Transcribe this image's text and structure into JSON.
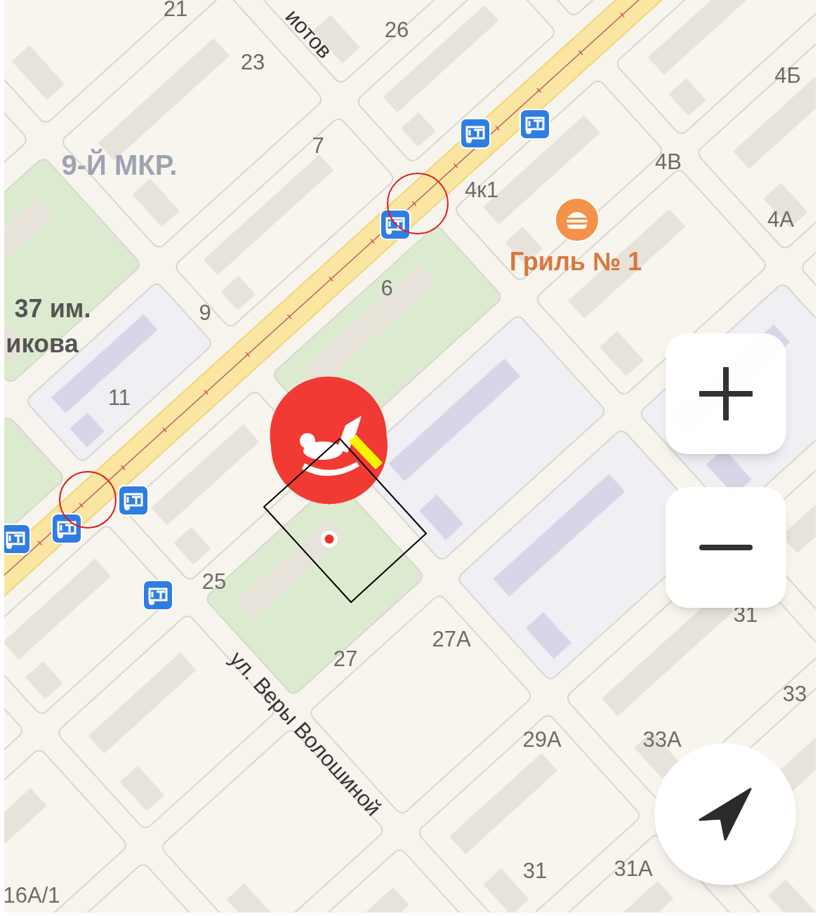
{
  "map": {
    "labels": [
      {
        "kind": "house",
        "text": "21"
      },
      {
        "kind": "street",
        "text": "иотов"
      },
      {
        "kind": "house",
        "text": "26"
      },
      {
        "kind": "house",
        "text": "23"
      },
      {
        "kind": "house",
        "text": "4Б"
      },
      {
        "kind": "house",
        "text": "7"
      },
      {
        "kind": "district",
        "text": "9-Й МКР."
      },
      {
        "kind": "house",
        "text": "4В"
      },
      {
        "kind": "house",
        "text": "4к1"
      },
      {
        "kind": "house",
        "text": "4А"
      },
      {
        "kind": "poi",
        "text": "Гриль № 1"
      },
      {
        "kind": "house",
        "text": "6"
      },
      {
        "kind": "place",
        "text": "37 им."
      },
      {
        "kind": "house",
        "text": "9"
      },
      {
        "kind": "place",
        "text": "икова"
      },
      {
        "kind": "house",
        "text": "11"
      },
      {
        "kind": "house",
        "text": "25"
      },
      {
        "kind": "house",
        "text": "31"
      },
      {
        "kind": "house",
        "text": "27А"
      },
      {
        "kind": "house",
        "text": "27"
      },
      {
        "kind": "house",
        "text": "33"
      },
      {
        "kind": "street",
        "text": "ул. Веры Волошиной"
      },
      {
        "kind": "house",
        "text": "29А"
      },
      {
        "kind": "house",
        "text": "33А"
      },
      {
        "kind": "house",
        "text": "31А"
      },
      {
        "kind": "house",
        "text": "31"
      },
      {
        "kind": "house",
        "text": "16А/1"
      }
    ]
  }
}
